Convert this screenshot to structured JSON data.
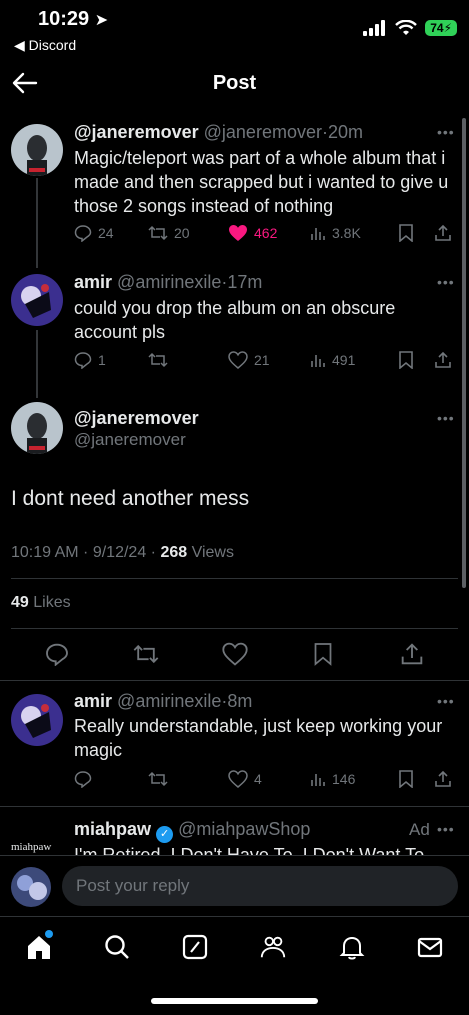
{
  "status_bar": {
    "time": "10:29",
    "back_app": "Discord",
    "battery": "74"
  },
  "header": {
    "title": "Post"
  },
  "tweets": [
    {
      "name": "@janeremover",
      "handle": "@janeremover",
      "time": "20m",
      "text": "Magic/teleport was part of a whole album that i made and then scrapped but i wanted to give u those 2 songs instead of nothing",
      "replies": "24",
      "reposts": "20",
      "likes": "462",
      "views": "3.8K",
      "liked": true
    },
    {
      "name": "amir",
      "handle": "@amirinexile",
      "time": "17m",
      "text": "could you drop the album on an obscure account pls",
      "replies": "1",
      "reposts": "",
      "likes": "21",
      "views": "491"
    }
  ],
  "focused": {
    "name": "@janeremover",
    "handle": "@janeremover",
    "text": "I dont need another mess",
    "time": "10:19 AM",
    "date": "9/12/24",
    "views_count": "268",
    "views_label": "Views",
    "likes_count": "49",
    "likes_label": "Likes"
  },
  "replies": [
    {
      "name": "amir",
      "handle": "@amirinexile",
      "time": "8m",
      "text": "Really understandable, just keep working your magic",
      "replies": "",
      "reposts": "",
      "likes": "4",
      "views": "146"
    }
  ],
  "ad": {
    "name": "miahpaw",
    "handle": "@miahpawShop",
    "label": "Ad",
    "text": "I'm Retired. I Don't Have To. I Don't Want To.",
    "logo_text": "miahpaw"
  },
  "reply_bar": {
    "placeholder": "Post your reply"
  },
  "colors": {
    "background": "#000000",
    "like_pink": "#f91880",
    "verified_blue": "#1d9bf0",
    "secondary_text": "#71767b"
  }
}
